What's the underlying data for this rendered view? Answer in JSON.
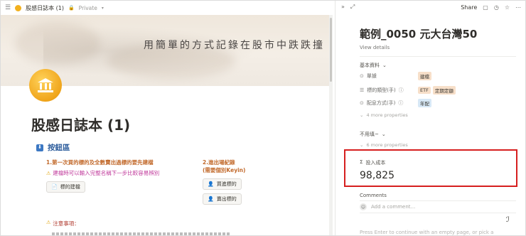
{
  "topbar": {
    "breadcrumb": "股感日誌本 (1)",
    "privacy": "Private"
  },
  "cover": {
    "motto": "用簡單的方式記錄在股市中跌跌撞"
  },
  "page": {
    "title": "股感日誌本 (1)"
  },
  "buttons_section": {
    "heading": "按鈕區",
    "step1": "1.第一次買的標的及全數賣出過標的要先建檔",
    "hint": "建檔時可以輸入完整名稱下一步比較容易辨別",
    "create_button": "標的建檔",
    "step2_line1": "2.進出場紀錄",
    "step2_line2": "(需要個別Keyin)",
    "buy_button": "買進標的",
    "sell_button": "賣出標的",
    "notice": "注意事項："
  },
  "peek": {
    "share": "Share",
    "title": "範例_0050 元大台灣50",
    "view_details": "View details",
    "group_basic": "基本資料",
    "props": [
      {
        "name": "單據",
        "tags": [
          {
            "text": "建檔",
            "color": "orange"
          }
        ]
      },
      {
        "name": "標的類型(手)",
        "tags": [
          {
            "text": "ETF",
            "color": "orange"
          },
          {
            "text": "定期定額",
            "color": "orange"
          }
        ]
      },
      {
        "name": "配息方式(手)",
        "tags": [
          {
            "text": "年配",
            "color": "blue"
          }
        ]
      }
    ],
    "more1": "4 more properties",
    "group_unused": "不用填~",
    "more2": "6 more properties",
    "stat_label": "投入成本",
    "stat_value": "98,825",
    "comments_heading": "Comments",
    "comment_placeholder": "Add a comment...",
    "enter_hint": "Press Enter to continue with an empty page, or pick a"
  },
  "colors": {
    "highlight_box": "#d61f1f",
    "section_heading": "#2c5c9c",
    "step_text": "#c26a2c",
    "hint_text": "#c0399b"
  }
}
